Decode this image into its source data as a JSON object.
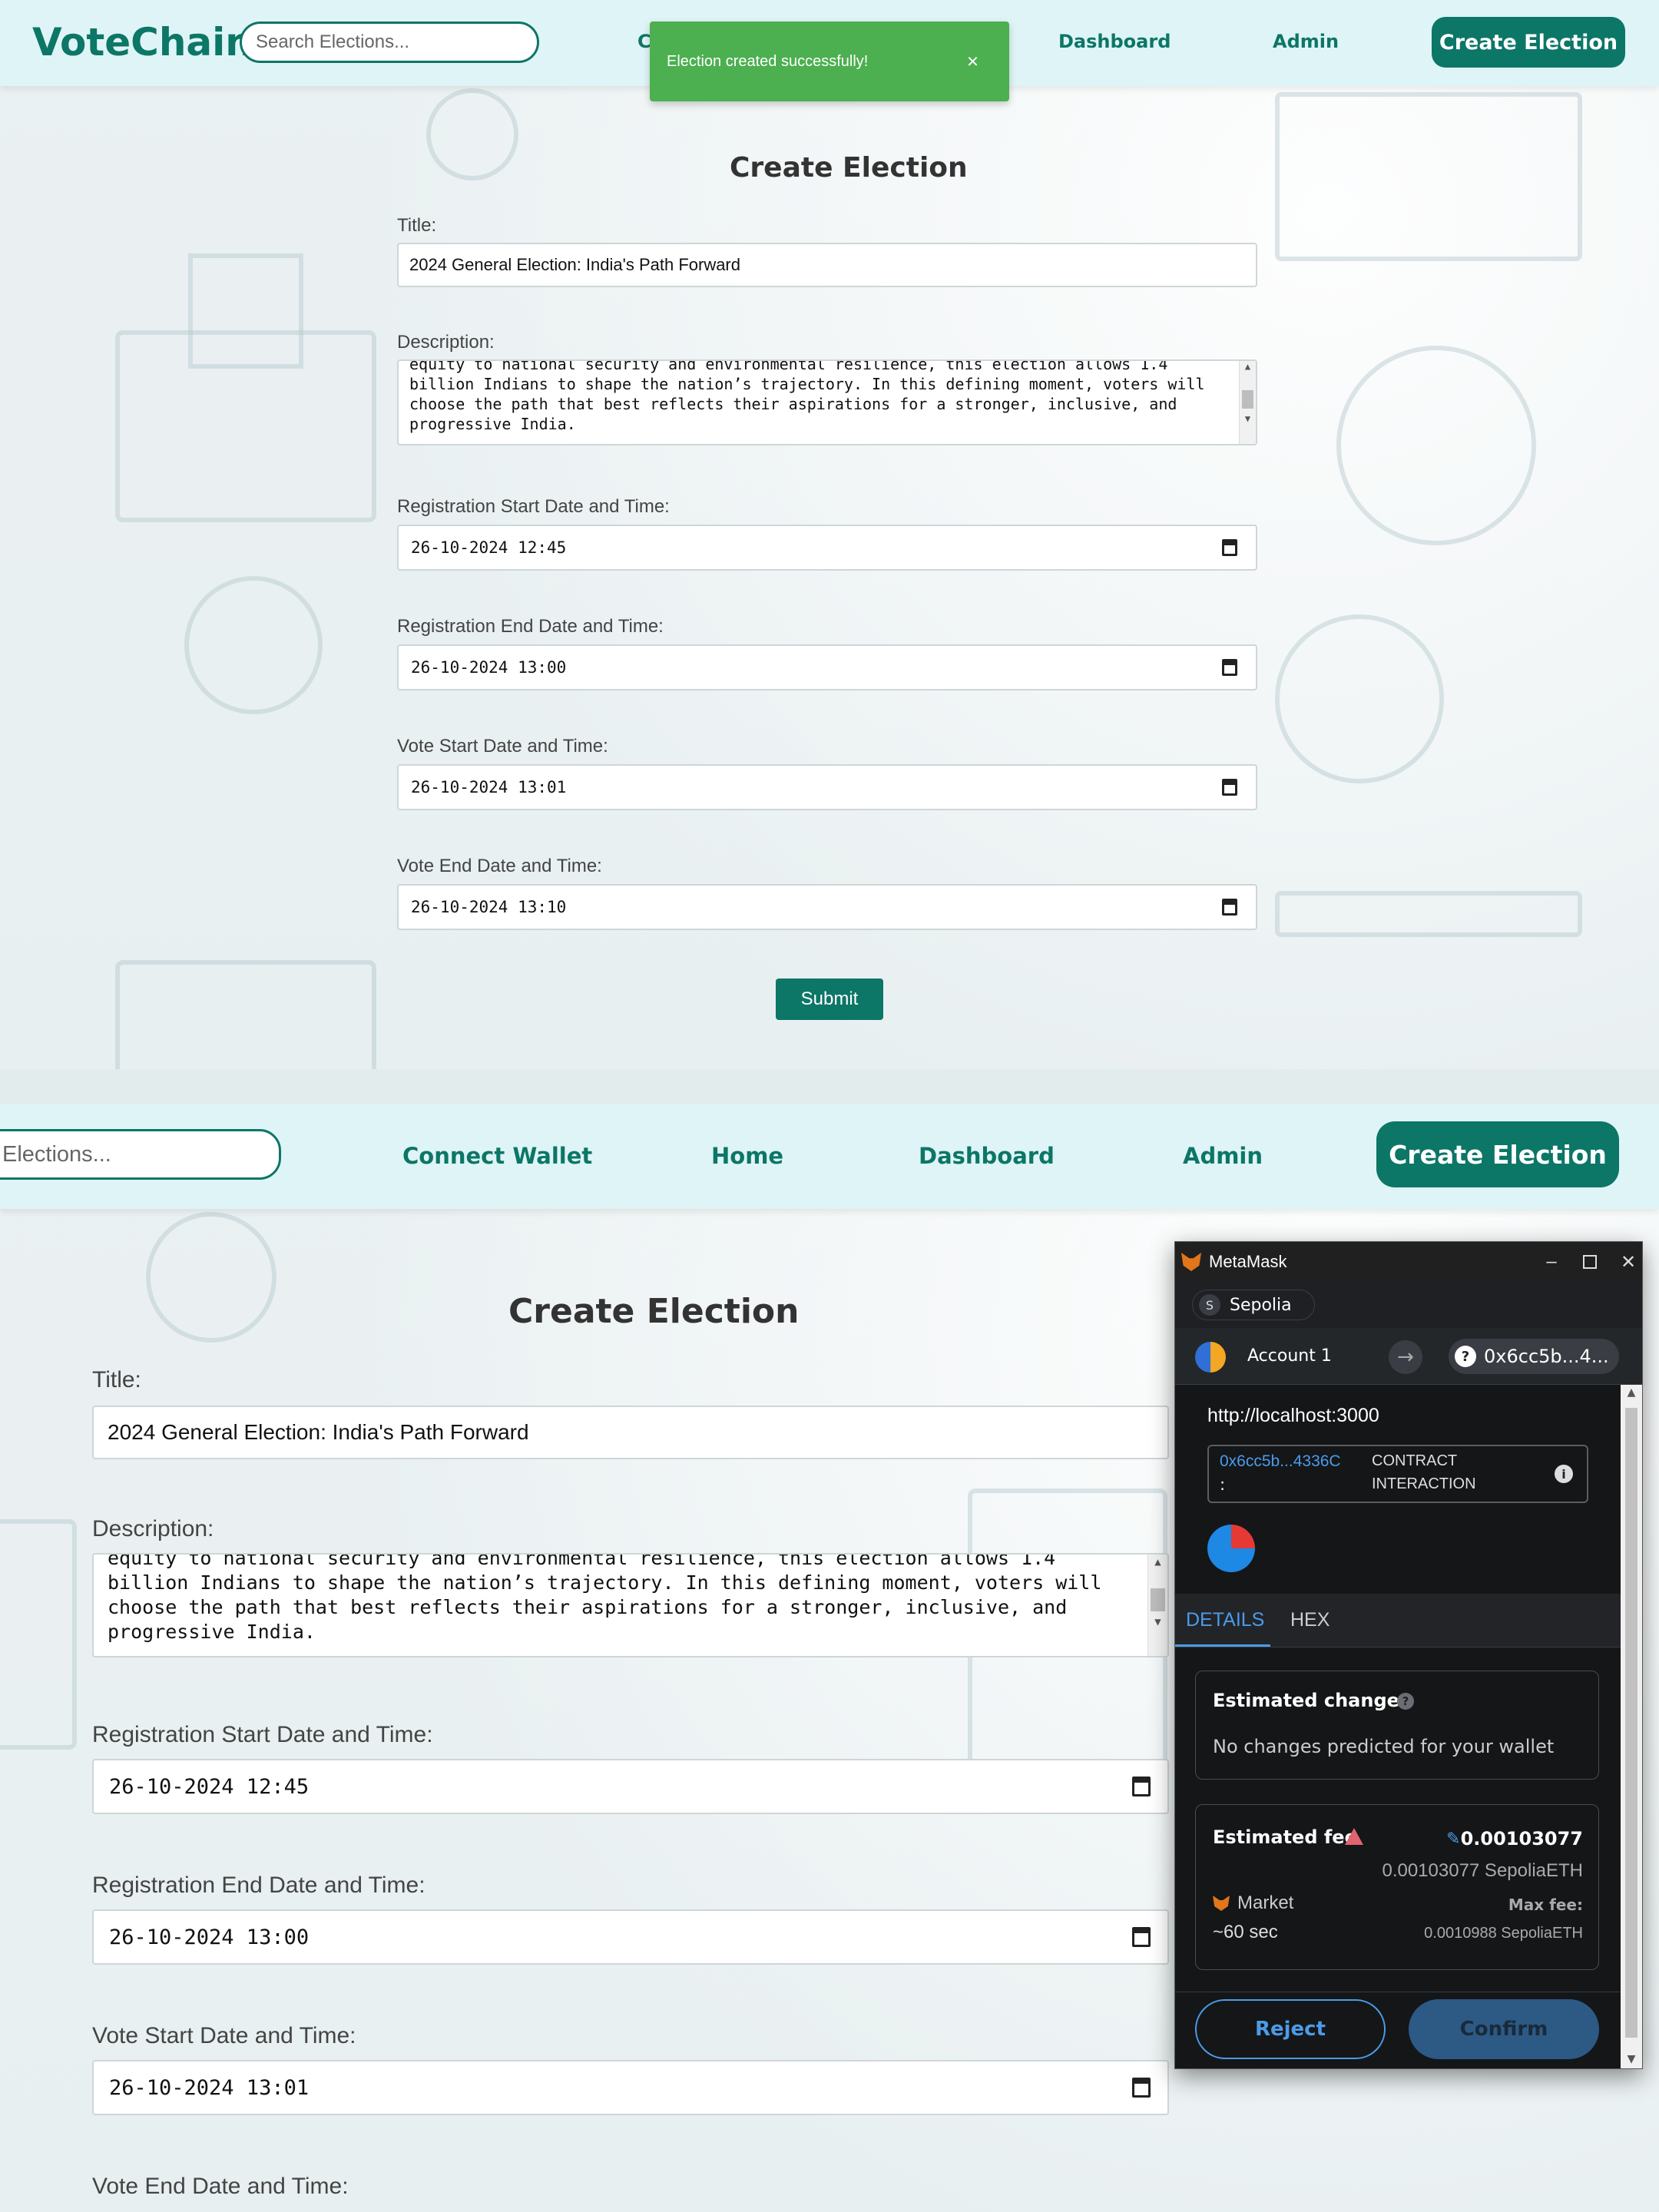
{
  "app": {
    "brand": "VoteChain"
  },
  "nav": {
    "search_placeholder": "Search Elections...",
    "search_partial": "Elections...",
    "connect_wallet": "Connect Wallet",
    "connect_partial": "C",
    "home": "Home",
    "dashboard": "Dashboard",
    "admin": "Admin",
    "create_election": "Create Election"
  },
  "toast": {
    "message": "Election created successfully!",
    "close": "×"
  },
  "form": {
    "heading": "Create Election",
    "title_label": "Title:",
    "title_value": "2024 General Election: India's Path Forward",
    "description_label": "Description:",
    "description_lines": [
      "equity to national security and environmental resilience, this election allows 1.4",
      "billion Indians to shape the nation’s trajectory. In this defining moment, voters will",
      "choose the path that best reflects their aspirations for a stronger, inclusive, and",
      "progressive India."
    ],
    "reg_start_label": "Registration Start Date and Time:",
    "reg_start_value": "26-10-2024 12:45",
    "reg_end_label": "Registration End Date and Time:",
    "reg_end_value": "26-10-2024 13:00",
    "vote_start_label": "Vote Start Date and Time:",
    "vote_start_value": "26-10-2024 13:01",
    "vote_end_label": "Vote End Date and Time:",
    "vote_end_value": "26-10-2024 13:10",
    "submit": "Submit"
  },
  "metamask": {
    "window_title": "MetaMask",
    "network_letter": "S",
    "network": "Sepolia",
    "account": "Account 1",
    "to_address": "0x6cc5b...4...",
    "origin": "http://localhost:3000",
    "contract_address": "0x6cc5b...4336C",
    "contract_colon": ":",
    "contract_type_line1": "CONTRACT",
    "contract_type_line2": "INTERACTION",
    "tab_details": "DETAILS",
    "tab_hex": "HEX",
    "estimated_changes_title": "Estimated changes",
    "estimated_changes_text": "No changes predicted for your wallet",
    "estimated_fee_title": "Estimated fee",
    "fee_value": "0.00103077",
    "fee_value_eth": "0.00103077 SepoliaETH",
    "market_label": "Market",
    "market_time": "~60 sec",
    "max_fee_label": "Max fee:",
    "max_fee_value": "0.0010988 SepoliaETH",
    "reject": "Reject",
    "confirm": "Confirm"
  }
}
